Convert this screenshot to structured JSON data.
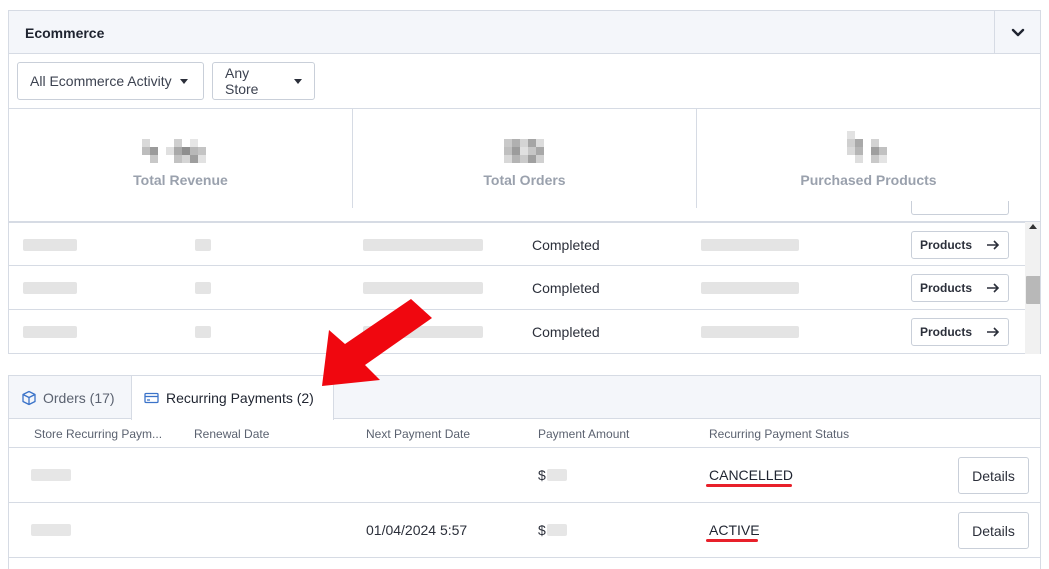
{
  "ecommerce": {
    "title": "Ecommerce",
    "filters": {
      "activity": "All Ecommerce Activity",
      "store": "Any Store"
    },
    "stats": [
      {
        "label": "Total Revenue"
      },
      {
        "label": "Total Orders"
      },
      {
        "label": "Purchased Products"
      }
    ],
    "orders": [
      {
        "status": "Completed",
        "button": "Products"
      },
      {
        "status": "Completed",
        "button": "Products"
      },
      {
        "status": "Completed",
        "button": "Products"
      }
    ]
  },
  "recurring": {
    "tabs": [
      {
        "label": "Orders (17)",
        "active": false
      },
      {
        "label": "Recurring Payments (2)",
        "active": true
      }
    ],
    "columns": [
      "Store Recurring Paym...",
      "Renewal Date",
      "Next Payment Date",
      "Payment Amount",
      "Recurring Payment Status"
    ],
    "rows": [
      {
        "next_payment": "",
        "amount_prefix": "$",
        "status": "CANCELLED",
        "button": "Details"
      },
      {
        "next_payment": "01/04/2024 5:57",
        "amount_prefix": "$",
        "status": "ACTIVE",
        "button": "Details"
      }
    ]
  },
  "colors": {
    "accent": "#e8202a",
    "border": "#d6dbe4",
    "header_bg": "#f4f6fa",
    "tab_icon": "#3b73c9"
  }
}
